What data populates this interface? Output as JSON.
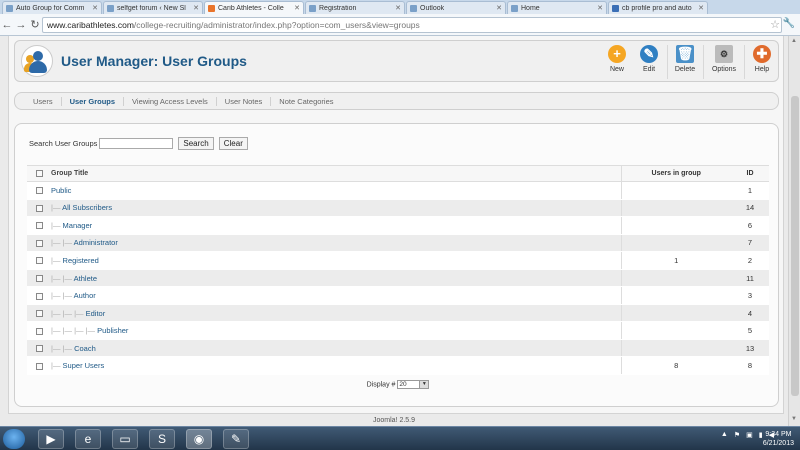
{
  "browser": {
    "tabs": [
      {
        "label": "Auto Group for Comm",
        "icon": "page-icon",
        "active": false
      },
      {
        "label": "selfget forum ‹ New Sl",
        "icon": "page-icon",
        "active": false
      },
      {
        "label": "Carib Athletes - Colle",
        "icon": "joomla-icon",
        "active": true
      },
      {
        "label": "Registration",
        "icon": "page-icon",
        "active": false
      },
      {
        "label": "Outlook",
        "icon": "page-icon",
        "active": false
      },
      {
        "label": "Home",
        "icon": "page-icon",
        "active": false
      },
      {
        "label": "cb profile pro and auto",
        "icon": "search-icon",
        "active": false
      }
    ],
    "url_domain": "www.caribathletes.com",
    "url_path": "/college-recruiting/administrator/index.php?option=com_users&view=groups"
  },
  "header": {
    "title": "User Manager: User Groups",
    "buttons": {
      "new": "New",
      "edit": "Edit",
      "delete": "Delete",
      "options": "Options",
      "help": "Help"
    }
  },
  "subnav": [
    "Users",
    "User Groups",
    "Viewing Access Levels",
    "User Notes",
    "Note Categories"
  ],
  "search": {
    "label": "Search User Groups",
    "value": "",
    "search_btn": "Search",
    "clear_btn": "Clear"
  },
  "table": {
    "columns": {
      "title": "Group Title",
      "users": "Users in group",
      "id": "ID"
    },
    "rows": [
      {
        "tree": "",
        "title": "Public",
        "users": "",
        "id": "1"
      },
      {
        "tree": "|—",
        "title": "All Subscribers",
        "users": "",
        "id": "14"
      },
      {
        "tree": "|—",
        "title": "Manager",
        "users": "",
        "id": "6"
      },
      {
        "tree": "|— |—",
        "title": "Administrator",
        "users": "",
        "id": "7"
      },
      {
        "tree": "|—",
        "title": "Registered",
        "users": "1",
        "id": "2"
      },
      {
        "tree": "|— |—",
        "title": "Athlete",
        "users": "",
        "id": "11"
      },
      {
        "tree": "|— |—",
        "title": "Author",
        "users": "",
        "id": "3"
      },
      {
        "tree": "|— |— |—",
        "title": "Editor",
        "users": "",
        "id": "4"
      },
      {
        "tree": "|— |— |— |—",
        "title": "Publisher",
        "users": "",
        "id": "5"
      },
      {
        "tree": "|— |—",
        "title": "Coach",
        "users": "",
        "id": "13"
      },
      {
        "tree": "|—",
        "title": "Super Users",
        "users": "8",
        "id": "8"
      }
    ]
  },
  "pagination": {
    "label": "Display #",
    "value": "20"
  },
  "footer": {
    "version": "Joomla! 2.5.9"
  },
  "taskbar": {
    "apps": [
      "media-player-icon",
      "internet-explorer-icon",
      "file-explorer-icon",
      "skype-icon",
      "chrome-icon",
      "paint-icon"
    ],
    "time": "9:34 PM",
    "date": "6/21/2013"
  },
  "colors": {
    "link": "#205a87",
    "new": "#f5a623",
    "edit": "#2f7fc2",
    "delete": "#4a90c8",
    "help": "#e06a2c"
  }
}
